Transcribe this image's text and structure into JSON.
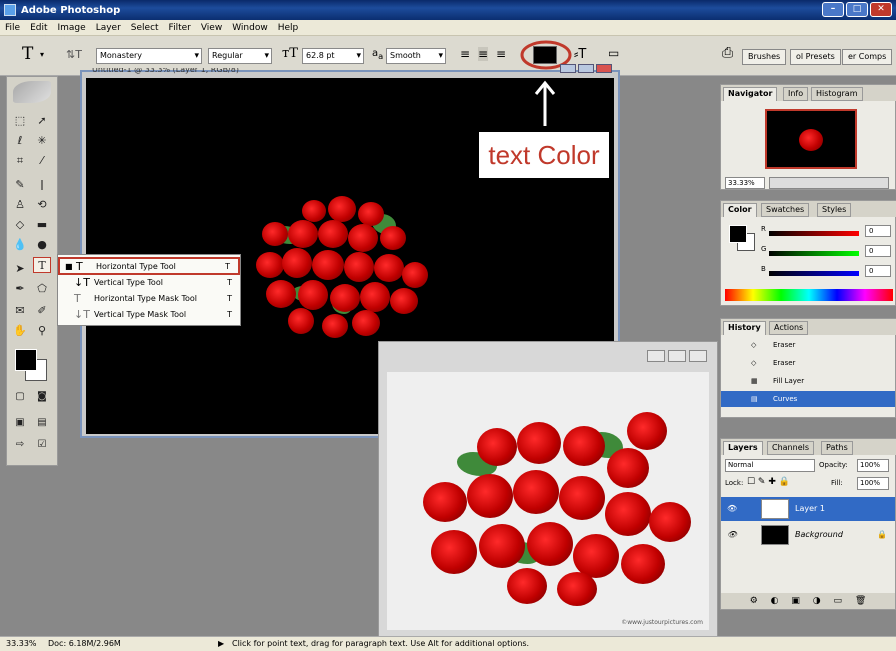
{
  "app": {
    "title": "Adobe Photoshop"
  },
  "menu": [
    "File",
    "Edit",
    "Image",
    "Layer",
    "Select",
    "Filter",
    "View",
    "Window",
    "Help"
  ],
  "options": {
    "font_family": "Monastery",
    "font_style": "Regular",
    "font_size": "62.8 pt",
    "aa_label": "a",
    "aa_mode": "Smooth",
    "color_hex": "#000000"
  },
  "palette_tabs": [
    "Brushes",
    "ol Presets",
    "er Comps"
  ],
  "document": {
    "title": "Untitled-1 @ 33.3% (Layer 1, RGB/8)"
  },
  "annotation": {
    "label": "text Color",
    "accent": "#c0392b"
  },
  "flyout": [
    {
      "label": "Horizontal Type Tool",
      "shortcut": "T",
      "selected": true
    },
    {
      "label": "Vertical Type Tool",
      "shortcut": "T",
      "selected": false
    },
    {
      "label": "Horizontal Type Mask Tool",
      "shortcut": "T",
      "selected": false
    },
    {
      "label": "Vertical Type Mask Tool",
      "shortcut": "T",
      "selected": false
    }
  ],
  "navigator": {
    "tabs": [
      "Navigator",
      "Info",
      "Histogram"
    ],
    "zoom": "33.33%"
  },
  "color": {
    "tabs": [
      "Color",
      "Swatches",
      "Styles"
    ],
    "channels": [
      {
        "label": "R",
        "value": "0"
      },
      {
        "label": "G",
        "value": "0"
      },
      {
        "label": "B",
        "value": "0"
      }
    ]
  },
  "history": {
    "tabs": [
      "History",
      "Actions"
    ],
    "items": [
      "Eraser",
      "Eraser",
      "Fill Layer",
      "Curves"
    ],
    "active_index": 3
  },
  "layers": {
    "tabs": [
      "Layers",
      "Channels",
      "Paths"
    ],
    "blend": "Normal",
    "opacity_label": "Opacity:",
    "opacity": "100%",
    "lock_label": "Lock:",
    "fill_label": "Fill:",
    "fill": "100%",
    "items": [
      {
        "name": "Layer 1",
        "active": true
      },
      {
        "name": "Background",
        "active": false
      }
    ]
  },
  "win2": {
    "watermark": "©www.justourpictures.com"
  },
  "status": {
    "zoom": "33.33%",
    "doc": "Doc: 6.18M/2.96M",
    "hint": "Click for point text, drag for paragraph text. Use Alt for additional options."
  }
}
